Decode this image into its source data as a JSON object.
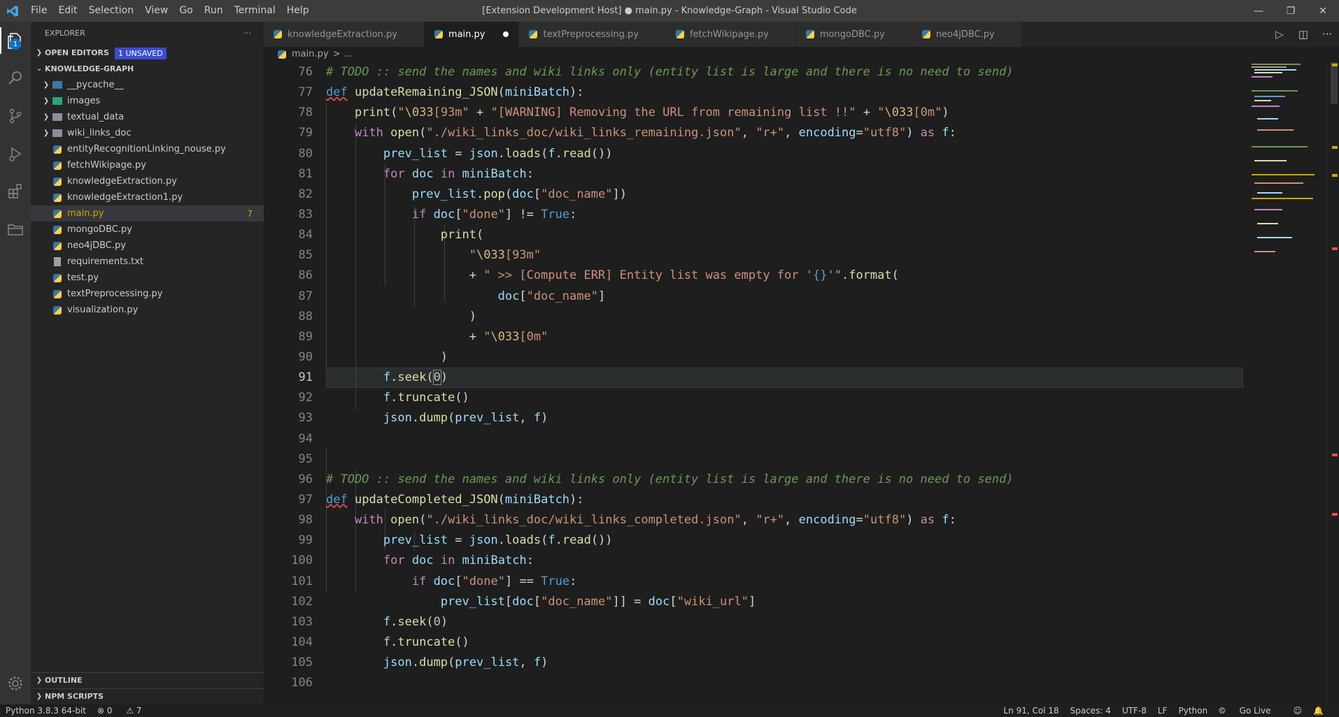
{
  "window": {
    "title": "[Extension Development Host] ● main.py - Knowledge-Graph - Visual Studio Code",
    "menu": [
      "File",
      "Edit",
      "Selection",
      "View",
      "Go",
      "Run",
      "Terminal",
      "Help"
    ]
  },
  "activity": {
    "explorer_badge": "1"
  },
  "sidebar": {
    "header": "EXPLORER",
    "more": "···",
    "open_editors": "OPEN EDITORS",
    "unsaved_badge": "1 UNSAVED",
    "project": "KNOWLEDGE-GRAPH",
    "folders": [
      "__pycache__",
      "images",
      "textual_data",
      "wiki_links_doc"
    ],
    "files": [
      "entityRecognitionLinking_nouse.py",
      "fetchWikipage.py",
      "knowledgeExtraction.py",
      "knowledgeExtraction1.py",
      "main.py",
      "mongoDBC.py",
      "neo4jDBC.py",
      "requirements.txt",
      "test.py",
      "textPreprocessing.py",
      "visualization.py"
    ],
    "main_problem_count": "7",
    "outline": "OUTLINE",
    "npm": "NPM SCRIPTS"
  },
  "tabs": [
    "knowledgeExtraction.py",
    "main.py",
    "textPreprocessing.py",
    "fetchWikipage.py",
    "mongoDBC.py",
    "neo4jDBC.py"
  ],
  "breadcrumb": {
    "file": "main.py",
    "sep": ">",
    "rest": "..."
  },
  "editor": {
    "line_numbers": [
      "76",
      "77",
      "78",
      "79",
      "80",
      "81",
      "82",
      "83",
      "84",
      "85",
      "86",
      "87",
      "88",
      "89",
      "90",
      "91",
      "92",
      "93",
      "94",
      "95",
      "96",
      "97",
      "98",
      "99",
      "100",
      "101",
      "102",
      "103",
      "104",
      "105",
      "106"
    ],
    "current_line": "91"
  },
  "statusbar": {
    "interpreter": "Python 3.8.3 64-bit",
    "errors": "0",
    "warnings": "7",
    "position": "Ln 91, Col 18",
    "spaces": "Spaces: 4",
    "encoding": "UTF-8",
    "eol": "LF",
    "language": "Python",
    "golive": "Go Live"
  },
  "colors": {
    "accent": "#0e70c0",
    "modified": "#cca700",
    "background": "#1e1e1e"
  }
}
